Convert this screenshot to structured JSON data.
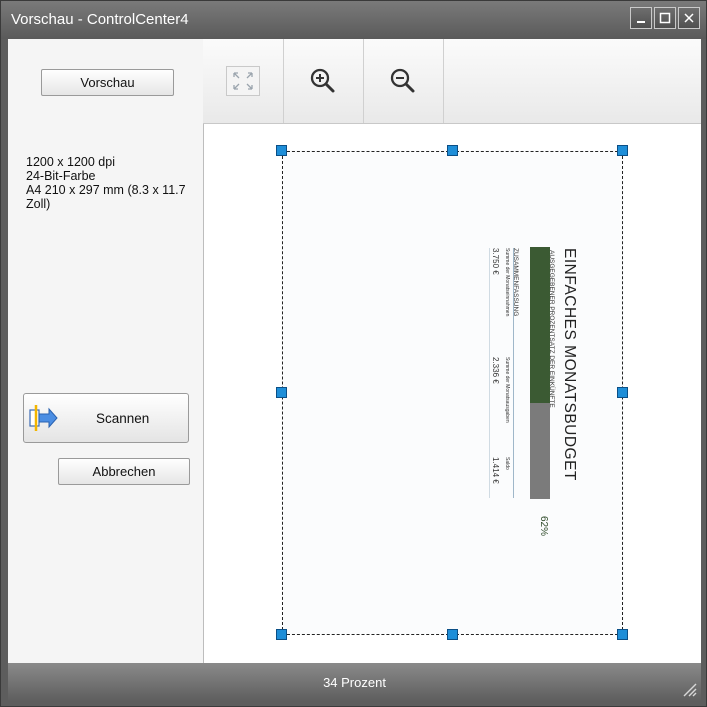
{
  "window": {
    "title": "Vorschau - ControlCenter4",
    "controls": [
      "minimize-icon",
      "maximize-icon",
      "close-icon"
    ]
  },
  "sidebar": {
    "preview_button": "Vorschau",
    "info": {
      "resolution": "1200 x 1200 dpi",
      "color": "24-Bit-Farbe",
      "size": "A4 210 x 297 mm (8.3 x 11.7 Zoll)"
    },
    "scan_button": "Scannen",
    "cancel_button": "Abbrechen"
  },
  "toolbar": {
    "buttons": [
      "fit-to-window-icon",
      "zoom-in-icon",
      "zoom-out-icon"
    ]
  },
  "document": {
    "title": "EINFACHES MONATSBUDGET",
    "subtitle": "AUSGEGEBENER PROZENTSATZ DER EINKÜNFTE",
    "summary_label": "ZUSAMMENFASSUNG",
    "income_label": "Summe der Monatseinnahmen",
    "income_value": "3.750 €",
    "expense_label": "Summe der Monatsausgaben",
    "expense_value": "2.336 €",
    "balance_label": "Saldo",
    "balance_value": "1.414 €",
    "percent": "62%",
    "bar_fill_fraction": 0.62,
    "colors": {
      "spent": "#3b5a33",
      "remaining": "#7b7b7b"
    }
  },
  "statusbar": {
    "zoom": "34 Prozent"
  }
}
